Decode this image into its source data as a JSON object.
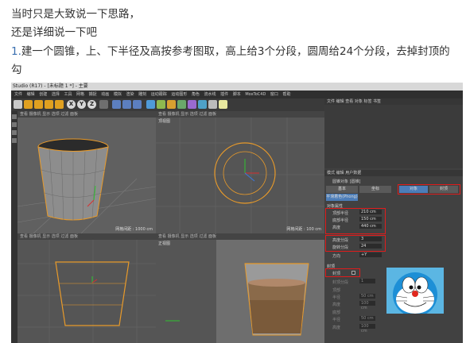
{
  "article": {
    "line1": "当时只是大致说一下思路，",
    "line2": "还是详细说一下吧",
    "step_number": "1.",
    "step_text": "建一个圆锥，上、下半径及高按参考图取，高上给3个分段，圆周给24个分段，去掉封顶的",
    "step_text_cont": "勾"
  },
  "screenshot": {
    "title": "Studio (R17) - [未标题 1 *] - 主要",
    "menu": [
      "文件",
      "编辑",
      "创建",
      "选择",
      "工具",
      "网格",
      "捕捉",
      "动画",
      "模拟",
      "渲染",
      "雕刻",
      "运动跟踪",
      "运动图形",
      "角色",
      "流水线",
      "插件",
      "脚本",
      "MoxToC4D",
      "窗口",
      "帮助"
    ],
    "toolbar_axes": [
      "X",
      "Y",
      "Z"
    ],
    "viewports": {
      "perspective": {
        "label": "",
        "header": "查看 摄像机 显示 选项 过滤 面板",
        "scale": "网格间距 : 1000 cm"
      },
      "top": {
        "label": "顶视图",
        "header": "查看 摄像机 显示 选项 过滤 面板",
        "scale": "网格间距 : 100 cm"
      },
      "front": {
        "label": "",
        "header": "查看 摄像机 显示 选项 过滤 面板",
        "scale": ""
      },
      "right": {
        "label": "正视图",
        "header": "查看 摄像机 显示 选项 过滤 面板",
        "scale": ""
      }
    },
    "object_manager": {
      "menu": [
        "文件",
        "编辑",
        "查看",
        "对象",
        "标签",
        "书签"
      ]
    },
    "attributes": {
      "menu": [
        "模式",
        "编辑",
        "用户数据"
      ],
      "object_name": "圆锥对象 [圆锥]",
      "tabs": [
        "基本",
        "坐标",
        "对象",
        "封顶"
      ],
      "phong": "平滑着色(Phong)",
      "section_object": "对象属性",
      "fields": [
        {
          "label": "顶部半径",
          "value": "210 cm"
        },
        {
          "label": "底部半径",
          "value": "150 cm"
        },
        {
          "label": "高度",
          "value": "440 cm"
        },
        {
          "label": "高度分段",
          "value": "3"
        },
        {
          "label": "旋转分段",
          "value": "24"
        },
        {
          "label": "方向",
          "value": "+Y"
        }
      ],
      "section_caps": "封顶",
      "caps_fields": [
        {
          "label": "封顶",
          "value": ""
        },
        {
          "label": "封顶分段",
          "value": "1"
        },
        {
          "label": "顶部",
          "value": ""
        },
        {
          "label": "半径",
          "value": "50 cm"
        },
        {
          "label": "高度",
          "value": "100 cm"
        },
        {
          "label": "底部",
          "value": ""
        },
        {
          "label": "半径",
          "value": "50 cm"
        },
        {
          "label": "高度",
          "value": "100 cm"
        }
      ]
    }
  }
}
